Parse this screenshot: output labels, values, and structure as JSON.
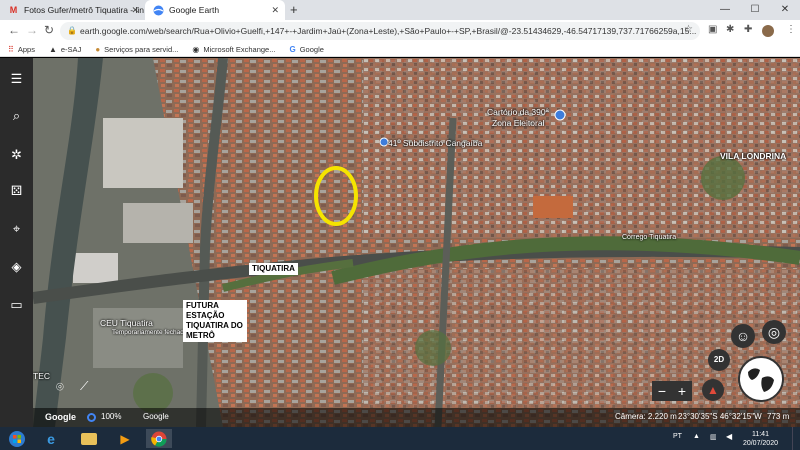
{
  "browser": {
    "tabs": [
      {
        "title": "Fotos Gufer/metrô Tiquatira - lin",
        "favicon": "gmail-icon"
      },
      {
        "title": "Google Earth",
        "favicon": "google-earth-icon"
      }
    ],
    "url": "earth.google.com/web/search/Rua+Olivio+Guelfi,+147+-+Jardim+Jaú+(Zona+Leste),+São+Paulo+-+SP,+Brasil/@-23.51434629,-46.54717139,737.71766259a,15..."
  },
  "bookmarks": [
    {
      "label": "Apps",
      "icon": "apps-grid-icon"
    },
    {
      "label": "e-SAJ",
      "icon": "esaj-icon"
    },
    {
      "label": "Serviços para servid...",
      "icon": "folder-icon"
    },
    {
      "label": "Microsoft Exchange...",
      "icon": "exchange-icon"
    },
    {
      "label": "Google",
      "icon": "google-icon"
    }
  ],
  "map": {
    "labels": {
      "cartorio": "Cartório da 390ª",
      "zona_eleitoral": "Zona Eleitoral",
      "subdistrito": "41º Subdistrito Cangaíba",
      "vila_londrina": "VILA LONDRINA",
      "corrego": "Córrego Tiquatira",
      "ceu": "CEU Tiquatira",
      "ceu_status": "Temporariamente fechado",
      "tec": "TEC"
    },
    "annotations": {
      "tiquatira": "TIQUATIRA",
      "futura": [
        "FUTURA",
        "ESTAÇÃO",
        "TIQUATIRA DO",
        "METRÔ"
      ]
    },
    "bottom_bar": {
      "brand": "Google",
      "zoom": "100%",
      "attribution": "Google",
      "camera": "Câmera: 2.220 m",
      "coords": "23°30'35\"S 46°32'15\"W",
      "altitude": "773 m"
    },
    "controls": {
      "view_mode": "2D",
      "zoom_out": "−",
      "zoom_in": "+"
    }
  },
  "taskbar": {
    "language": "PT",
    "time": "11:41",
    "date": "20/07/2020"
  },
  "colors": {
    "highlight": "#f5e400",
    "rail": "#2b2b2b",
    "taskbar": "#1c2b3c"
  }
}
